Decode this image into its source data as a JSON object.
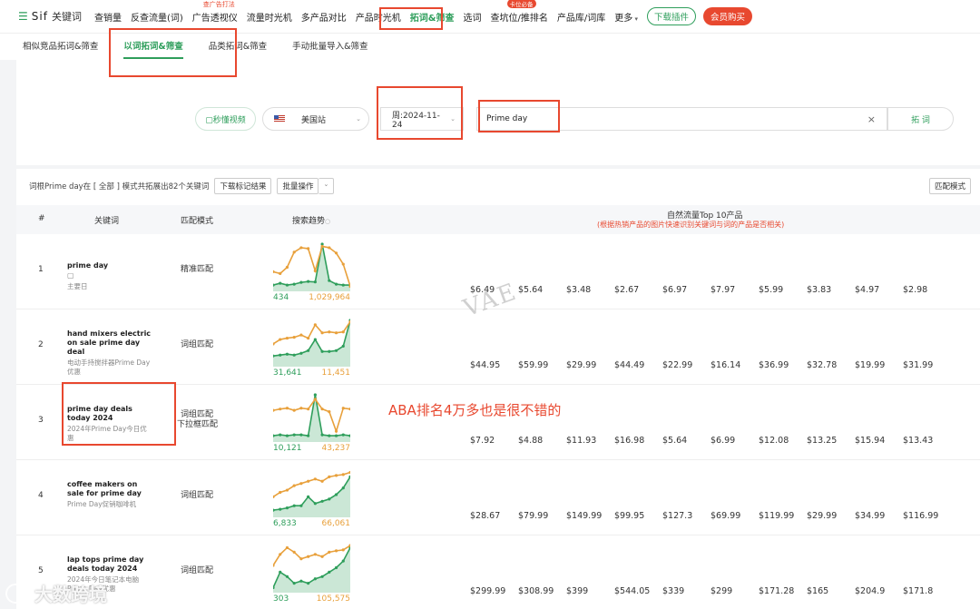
{
  "nav": {
    "logo": "Sif",
    "logo_sub": "关键词",
    "items": [
      {
        "label": "查销量",
        "sup": "",
        "badge": ""
      },
      {
        "label": "反查流量(词)",
        "sup": "",
        "badge": ""
      },
      {
        "label": "广告透视仪",
        "sup": "查广告打法",
        "badge": ""
      },
      {
        "label": "流量时光机",
        "sup": "",
        "badge": ""
      },
      {
        "label": "多产品对比",
        "sup": "",
        "badge": ""
      },
      {
        "label": "产品时光机",
        "sup": "",
        "badge": ""
      },
      {
        "label": "拓词&筛查",
        "sup": "",
        "badge": ""
      },
      {
        "label": "选词",
        "sup": "",
        "badge": ""
      },
      {
        "label": "查坑位/推排名",
        "sup": "",
        "badge": "卡位必备"
      },
      {
        "label": "产品库/词库",
        "sup": "",
        "badge": ""
      },
      {
        "label": "更多",
        "sup": "",
        "badge": ""
      }
    ],
    "download_label": "下载插件",
    "vip_label": "会员购买"
  },
  "subnav": [
    "相似竞品拓词&筛查",
    "以词拓词&筛查",
    "品类拓词&筛查",
    "手动批量导入&筛查"
  ],
  "search": {
    "video_label": "▢秒懂视频",
    "site": "美国站",
    "week": "周:2024-11-24",
    "keyword": "Prime day",
    "clear": "×",
    "go_label": "拓 词"
  },
  "results": {
    "info": "词根Prime day在 [ 全部 ] 模式共拓展出82个关键词",
    "download_label": "下载标记结果",
    "batch_label": "批量操作",
    "batch_caret": "⌄",
    "match_mode": "匹配模式",
    "headers": {
      "num": "#",
      "keyword": "关键词",
      "match": "匹配模式",
      "trend": "搜索趋势",
      "top10": "自然流量Top 10产品",
      "top10_sub": "(根据热销产品的图片快速识别关键词与词的产品是否相关)"
    },
    "rows": [
      {
        "num": "1",
        "kw": "prime day",
        "zh": "主要日",
        "match": "精准匹配",
        "match2": "",
        "lo": "434",
        "hi": "1,029,964",
        "prices": [
          "$6.49",
          "$5.64",
          "$3.48",
          "$2.67",
          "$6.97",
          "$7.97",
          "$5.99",
          "$3.83",
          "$4.97",
          "$2.98"
        ],
        "trend_orange": [
          0.62,
          0.66,
          0.52,
          0.18,
          0.08,
          0.1,
          0.6,
          0.05,
          0.08,
          0.2,
          0.45,
          0.95
        ],
        "trend_green": [
          0.92,
          0.88,
          0.92,
          0.9,
          0.86,
          0.84,
          0.85,
          0.0,
          0.82,
          0.9,
          0.92,
          0.92
        ]
      },
      {
        "num": "2",
        "kw": "hand mixers electric on sale prime day deal",
        "zh": "电动手持搅拌器Prime Day优惠",
        "match": "词组匹配",
        "match2": "",
        "lo": "31,641",
        "hi": "11,451",
        "prices": [
          "$44.95",
          "$59.99",
          "$29.99",
          "$44.49",
          "$22.99",
          "$16.14",
          "$36.99",
          "$32.78",
          "$19.99",
          "$31.99"
        ],
        "trend_orange": [
          0.55,
          0.45,
          0.42,
          0.4,
          0.35,
          0.42,
          0.12,
          0.3,
          0.28,
          0.3,
          0.28,
          0.05
        ],
        "trend_green": [
          0.82,
          0.8,
          0.78,
          0.8,
          0.76,
          0.7,
          0.45,
          0.72,
          0.72,
          0.7,
          0.6,
          0.02
        ]
      },
      {
        "num": "3",
        "kw": "prime day deals today 2024",
        "zh": "2024年Prime Day今日优惠",
        "match": "词组匹配",
        "match2": "下拉框匹配",
        "lo": "10,121",
        "hi": "43,237",
        "prices": [
          "$7.92",
          "$4.88",
          "$11.93",
          "$16.98",
          "$5.64",
          "$6.99",
          "$12.08",
          "$13.25",
          "$15.94",
          "$13.43"
        ],
        "trend_orange": [
          0.35,
          0.32,
          0.3,
          0.35,
          0.3,
          0.32,
          0.1,
          0.32,
          0.38,
          0.82,
          0.3,
          0.32
        ],
        "trend_green": [
          0.92,
          0.9,
          0.92,
          0.9,
          0.9,
          0.92,
          0.0,
          0.9,
          0.92,
          0.92,
          0.9,
          0.92
        ]
      },
      {
        "num": "4",
        "kw": "coffee makers on sale for prime day",
        "zh": "Prime Day促销咖啡机",
        "match": "词组匹配",
        "match2": "",
        "lo": "6,833",
        "hi": "66,061",
        "prices": [
          "$28.67",
          "$79.99",
          "$149.99",
          "$99.95",
          "$127.3",
          "$69.99",
          "$119.99",
          "$29.99",
          "$34.99",
          "$116.99"
        ],
        "trend_orange": [
          0.6,
          0.5,
          0.45,
          0.35,
          0.3,
          0.25,
          0.2,
          0.25,
          0.15,
          0.12,
          0.1,
          0.05
        ],
        "trend_green": [
          0.9,
          0.88,
          0.85,
          0.8,
          0.8,
          0.6,
          0.75,
          0.7,
          0.65,
          0.55,
          0.4,
          0.15
        ]
      },
      {
        "num": "5",
        "kw": "lap tops prime day deals today 2024",
        "zh": "2024年今日笔记本电脑Prime Day优惠",
        "match": "词组匹配",
        "match2": "",
        "lo": "303",
        "hi": "105,575",
        "prices": [
          "$299.99",
          "$308.99",
          "$399",
          "$544.05",
          "$339",
          "$299",
          "$171.28",
          "$165",
          "$204.9",
          "$171.8"
        ],
        "trend_orange": [
          0.45,
          0.2,
          0.05,
          0.15,
          0.3,
          0.25,
          0.2,
          0.25,
          0.15,
          0.12,
          0.1,
          0.0
        ],
        "trend_green": [
          0.95,
          0.6,
          0.7,
          0.85,
          0.8,
          0.85,
          0.75,
          0.7,
          0.6,
          0.5,
          0.35,
          0.05
        ]
      }
    ]
  },
  "overlays": {
    "watermark": "VAE",
    "annotation": "ABA排名4万多也是很不错的",
    "footer_watermark": "大数跨境"
  },
  "colors": {
    "accent": "#2e9e5b",
    "orange": "#e8a03b",
    "red": "#e8482f"
  }
}
